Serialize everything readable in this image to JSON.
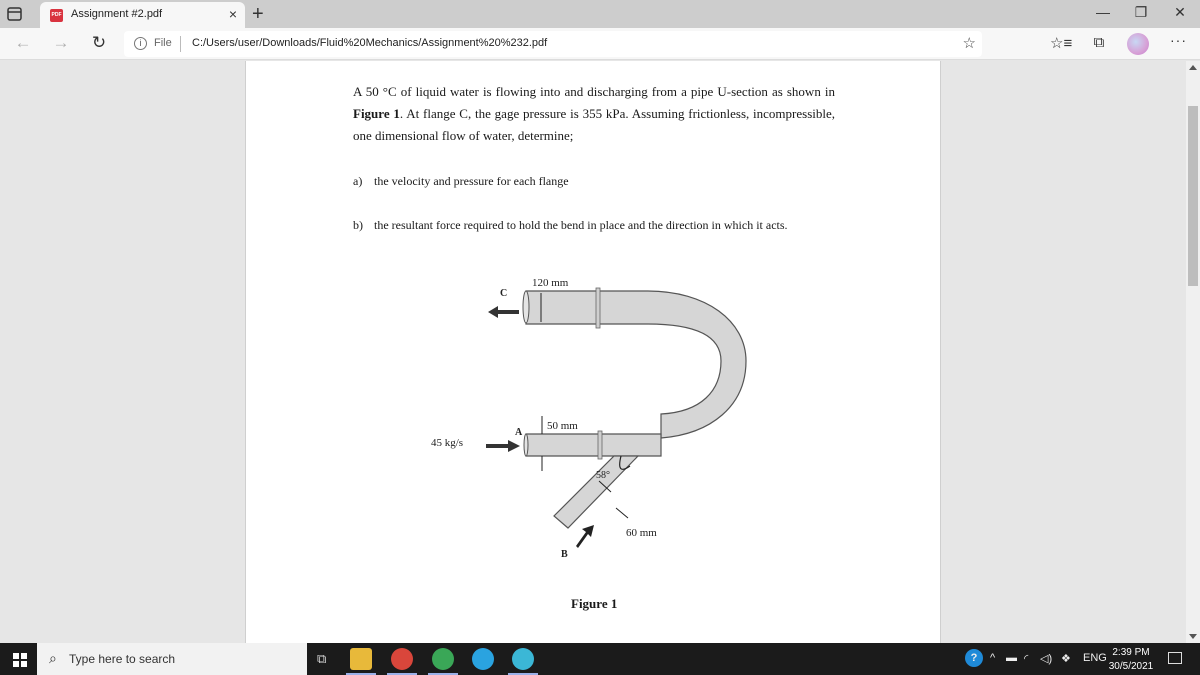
{
  "browser": {
    "tab": {
      "title": "Assignment #2.pdf",
      "favicon": "pdf-icon",
      "close": "×"
    },
    "new_tab": "+",
    "window_controls": {
      "minimize": "—",
      "restore": "❐",
      "close": "✕"
    },
    "nav": {
      "back": "←",
      "forward": "→",
      "reload": "↻"
    },
    "address": {
      "info_icon": "i",
      "scheme_label": "File",
      "url": "C:/Users/user/Downloads/Fluid%20Mechanics/Assignment%20%232.pdf"
    },
    "toolbar_icons": {
      "add_favorite": "☆",
      "favorites": "☆≡",
      "collections": "⧉",
      "more": "···"
    }
  },
  "document": {
    "paragraph": {
      "line1": "A 50 °C of liquid water is flowing into and discharging from a pipe U-section as shown in",
      "figure_ref": "Figure 1",
      "line2_rest": ". At flange C, the gage pressure is 355 kPa. Assuming frictionless, incompressible, one dimensional flow of water, determine;"
    },
    "items": [
      {
        "label": "a)",
        "text": "the velocity and pressure for each flange"
      },
      {
        "label": "b)",
        "text": "the resultant force required to hold the bend in place and the direction in which it acts."
      }
    ],
    "figure": {
      "labels": {
        "c": "C",
        "a": "A",
        "b": "B",
        "dia_c": "120 mm",
        "dia_a": "50 mm",
        "dia_b": "60 mm",
        "mass_flow": "45 kg/s",
        "angle": "58°"
      },
      "caption": "Figure 1"
    }
  },
  "taskbar": {
    "search_placeholder": "Type here to search",
    "search_icon": "⌕",
    "task_view_icon": "⧉",
    "apps": [
      {
        "name": "file-explorer",
        "color": "#e8b93a"
      },
      {
        "name": "chrome-profile-1",
        "color": "#d9463b"
      },
      {
        "name": "chrome-profile-2",
        "color": "#3aa757"
      },
      {
        "name": "telegram",
        "color": "#2aa3e0"
      },
      {
        "name": "edge",
        "color": "#3bb7d6"
      }
    ],
    "tray": {
      "help": "?",
      "chevron": "^",
      "language": "ENG",
      "time": "2:39 PM",
      "date": "30/5/2021"
    }
  }
}
